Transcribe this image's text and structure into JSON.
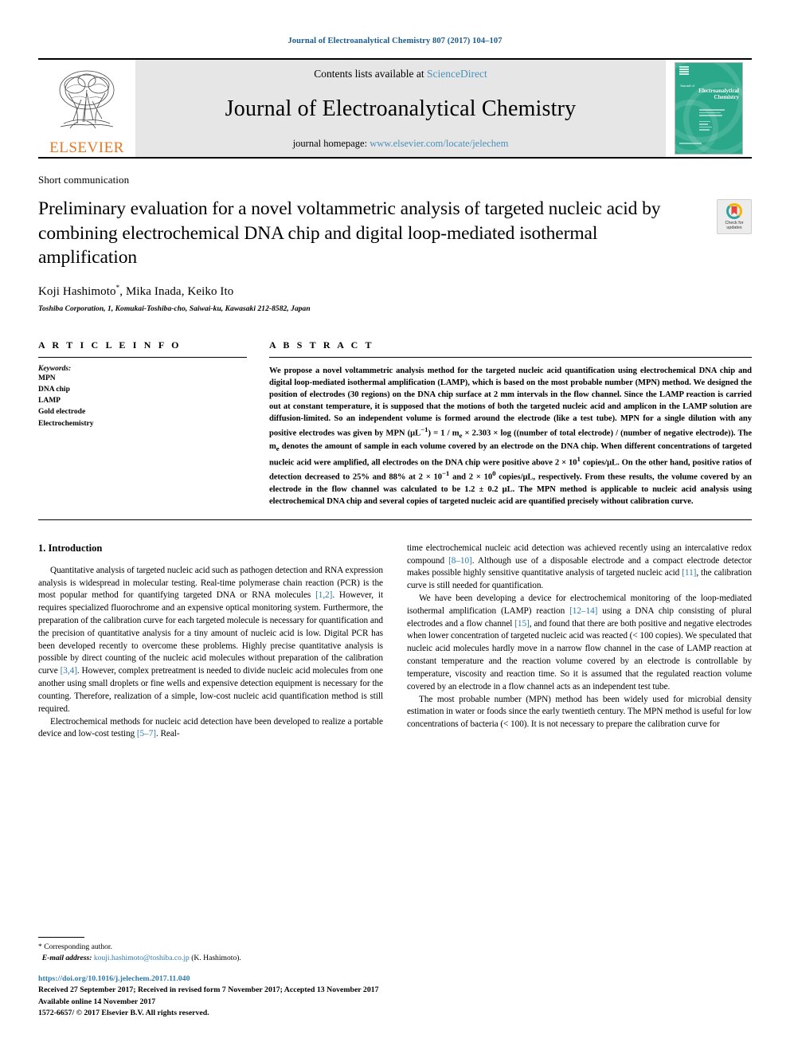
{
  "running_head": "Journal of Electroanalytical Chemistry 807 (2017) 104–107",
  "masthead": {
    "contents_prefix": "Contents lists available at ",
    "sciencedirect": "ScienceDirect",
    "journal_name": "Journal of Electroanalytical Chemistry",
    "homepage_prefix": "journal homepage: ",
    "homepage_url": "www.elsevier.com/locate/jelechem",
    "publisher": "ELSEVIER",
    "cover_title_line1": "Journal of",
    "cover_title_line2": "Electroanalytical",
    "cover_title_line3": "Chemistry",
    "accent_color": "#4a90b8",
    "elsevier_orange": "#E87722",
    "cover_teal": "#2aa889"
  },
  "article": {
    "section_type": "Short communication",
    "title": "Preliminary evaluation for a novel voltammetric analysis of targeted nucleic acid by combining electrochemical DNA chip and digital loop-mediated isothermal amplification",
    "authors": "Koji Hashimoto*, Mika Inada, Keiko Ito",
    "affiliation": "Toshiba Corporation, 1, Komukai-Toshiba-cho, Saiwai-ku, Kawasaki 212-8582, Japan",
    "crossmark_label_line1": "Check for",
    "crossmark_label_line2": "updates"
  },
  "article_info": {
    "heading": "A R T I C L E   I N F O",
    "keywords_label": "Keywords:",
    "keywords": [
      "MPN",
      "DNA chip",
      "LAMP",
      "Gold electrode",
      "Electrochemistry"
    ]
  },
  "abstract": {
    "heading": "A B S T R A C T",
    "text": "We propose a novel voltammetric analysis method for the targeted nucleic acid quantification using electrochemical DNA chip and digital loop-mediated isothermal amplification (LAMP), which is based on the most probable number (MPN) method. We designed the position of electrodes (30 regions) on the DNA chip surface at 2 mm intervals in the flow channel. Since the LAMP reaction is carried out at constant temperature, it is supposed that the motions of both the targeted nucleic acid and amplicon in the LAMP solution are diffusion-limited. So an independent volume is formed around the electrode (like a test tube). MPN for a single dilution with any positive electrodes was given by MPN (μL−1) = 1 / me × 2.303 × log ((number of total electrode) / (number of negative electrode)). The me denotes the amount of sample in each volume covered by an electrode on the DNA chip. When different concentrations of targeted nucleic acid were amplified, all electrodes on the DNA chip were positive above 2 × 101 copies/μL. On the other hand, positive ratios of detection decreased to 25% and 88% at 2 × 10−1 and 2 × 100 copies/μL, respectively. From these results, the volume covered by an electrode in the flow channel was calculated to be 1.2 ± 0.2 μL. The MPN method is applicable to nucleic acid analysis using electrochemical DNA chip and several copies of targeted nucleic acid are quantified precisely without calibration curve."
  },
  "introduction": {
    "heading": "1. Introduction",
    "left_paragraphs": [
      "Quantitative analysis of targeted nucleic acid such as pathogen detection and RNA expression analysis is widespread in molecular testing. Real-time polymerase chain reaction (PCR) is the most popular method for quantifying targeted DNA or RNA molecules [1,2]. However, it requires specialized fluorochrome and an expensive optical monitoring system. Furthermore, the preparation of the calibration curve for each targeted molecule is necessary for quantification and the precision of quantitative analysis for a tiny amount of nucleic acid is low. Digital PCR has been developed recently to overcome these problems. Highly precise quantitative analysis is possible by direct counting of the nucleic acid molecules without preparation of the calibration curve [3,4]. However, complex pretreatment is needed to divide nucleic acid molecules from one another using small droplets or fine wells and expensive detection equipment is necessary for the counting. Therefore, realization of a simple, low-cost nucleic acid quantification method is still required.",
      "Electrochemical methods for nucleic acid detection have been developed to realize a portable device and low-cost testing [5–7]. Real-"
    ],
    "right_paragraphs": [
      "time electrochemical nucleic acid detection was achieved recently using an intercalative redox compound [8–10]. Although use of a disposable electrode and a compact electrode detector makes possible highly sensitive quantitative analysis of targeted nucleic acid [11], the calibration curve is still needed for quantification.",
      "We have been developing a device for electrochemical monitoring of the loop-mediated isothermal amplification (LAMP) reaction [12–14] using a DNA chip consisting of plural electrodes and a flow channel [15], and found that there are both positive and negative electrodes when lower concentration of targeted nucleic acid was reacted (< 100 copies). We speculated that nucleic acid molecules hardly move in a narrow flow channel in the case of LAMP reaction at constant temperature and the reaction volume covered by an electrode is controllable by temperature, viscosity and reaction time. So it is assumed that the regulated reaction volume covered by an electrode in a flow channel acts as an independent test tube.",
      "The most probable number (MPN) method has been widely used for microbial density estimation in water or foods since the early twentieth century. The MPN method is useful for low concentrations of bacteria (< 100). It is not necessary to prepare the calibration curve for"
    ]
  },
  "footer": {
    "corresponding_author": "* Corresponding author.",
    "email_label": "E-mail address:",
    "email": "kouji.hashimoto@toshiba.co.jp",
    "email_suffix": "(K. Hashimoto).",
    "doi": "https://doi.org/10.1016/j.jelechem.2017.11.040",
    "received": "Received 27 September 2017; Received in revised form 7 November 2017; Accepted 13 November 2017",
    "available": "Available online 14 November 2017",
    "copyright": "1572-6657/ © 2017 Elsevier B.V. All rights reserved."
  }
}
